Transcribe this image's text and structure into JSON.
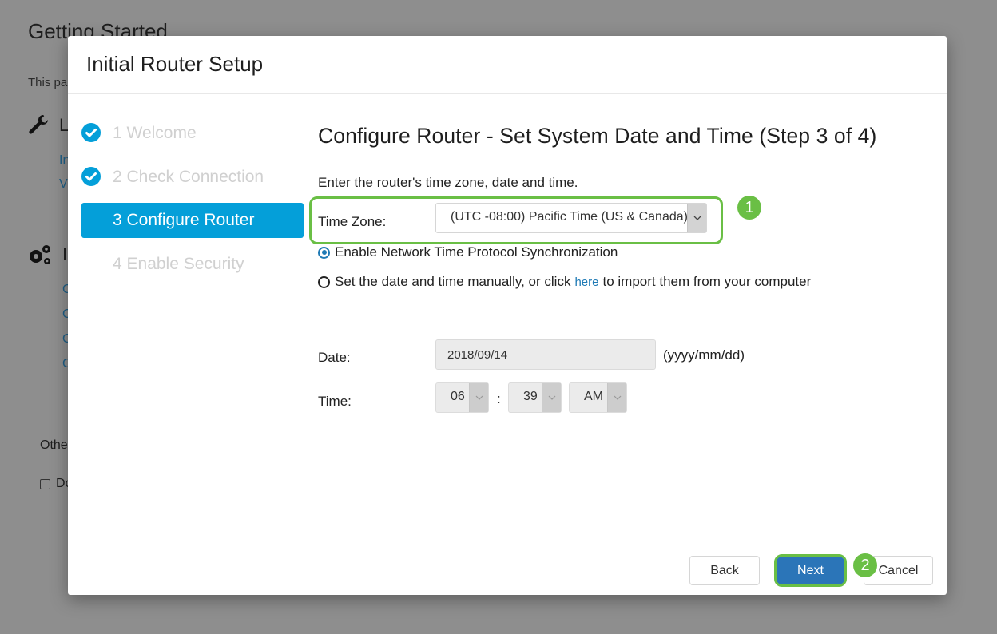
{
  "background_page": {
    "title": "Getting Started",
    "intro_text": "This pa",
    "section1_label": "L",
    "section1_links": [
      "In",
      "V"
    ],
    "section2_label": "I",
    "section2_links": [
      "C",
      "C",
      "C",
      "C"
    ],
    "other_label": "Othe",
    "checkbox_label": "Do"
  },
  "modal": {
    "title": "Initial Router Setup",
    "steps": [
      {
        "label": "1 Welcome",
        "state": "completed"
      },
      {
        "label": "2 Check Connection",
        "state": "completed"
      },
      {
        "label": "3 Configure Router",
        "state": "active"
      },
      {
        "label": "4 Enable Security",
        "state": "pending"
      }
    ],
    "content": {
      "title": "Configure Router - Set System Date and Time (Step 3 of 4)",
      "instructions": "Enter the router's time zone, date and time.",
      "time_zone": {
        "label": "Time Zone:",
        "value": "(UTC -08:00) Pacific Time (US & Canada)"
      },
      "ntp_option": {
        "label": "Enable Network Time Protocol Synchronization",
        "selected": true
      },
      "manual_option": {
        "label_before": "Set the date and time manually, or click",
        "link": "here",
        "label_after": "to import them from your computer",
        "selected": false
      },
      "date": {
        "label": "Date:",
        "value": "2018/09/14",
        "hint": "(yyyy/mm/dd)"
      },
      "time": {
        "label": "Time:",
        "hour": "06",
        "separator": ":",
        "minute": "39",
        "ampm": "AM"
      }
    },
    "footer": {
      "back_label": "Back",
      "next_label": "Next",
      "cancel_label": "Cancel"
    }
  },
  "annotations": {
    "badge1": "1",
    "badge2": "2",
    "highlight_color": "#6abf45"
  },
  "colors": {
    "accent": "#049fd9",
    "primary_button": "#2b75b8",
    "link": "#1f7ab5"
  }
}
